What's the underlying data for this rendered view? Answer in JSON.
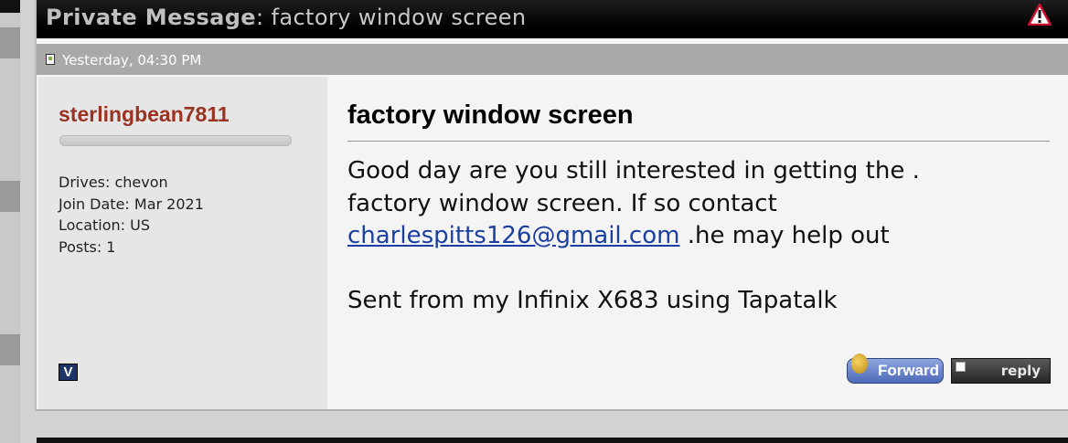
{
  "header": {
    "title_bold": "Private Message",
    "title_rest": ": factory window screen",
    "warning_icon": "warning-triangle-icon"
  },
  "post": {
    "date": "Yesterday, 04:30 PM",
    "doc_icon": "post-document-icon"
  },
  "user": {
    "name": "sterlingbean7811",
    "drives": "Drives: chevon",
    "join_date": "Join Date: Mar 2021",
    "location": "Location: US",
    "posts": "Posts: 1",
    "badge": "V"
  },
  "message": {
    "subject": "factory window screen",
    "line1": "Good day are you still interested in getting the .",
    "line2": "factory window screen. If so contact",
    "email": "charlespitts126@gmail.com",
    "line3_rest": " .he may help out",
    "signature": "Sent from my Infinix X683 using Tapatalk"
  },
  "actions": {
    "forward_label": "Forward",
    "reply_label": "reply"
  },
  "colors": {
    "username": "#9a3322",
    "link": "#1a3fa0",
    "date_bar": "#a9a9a9"
  }
}
